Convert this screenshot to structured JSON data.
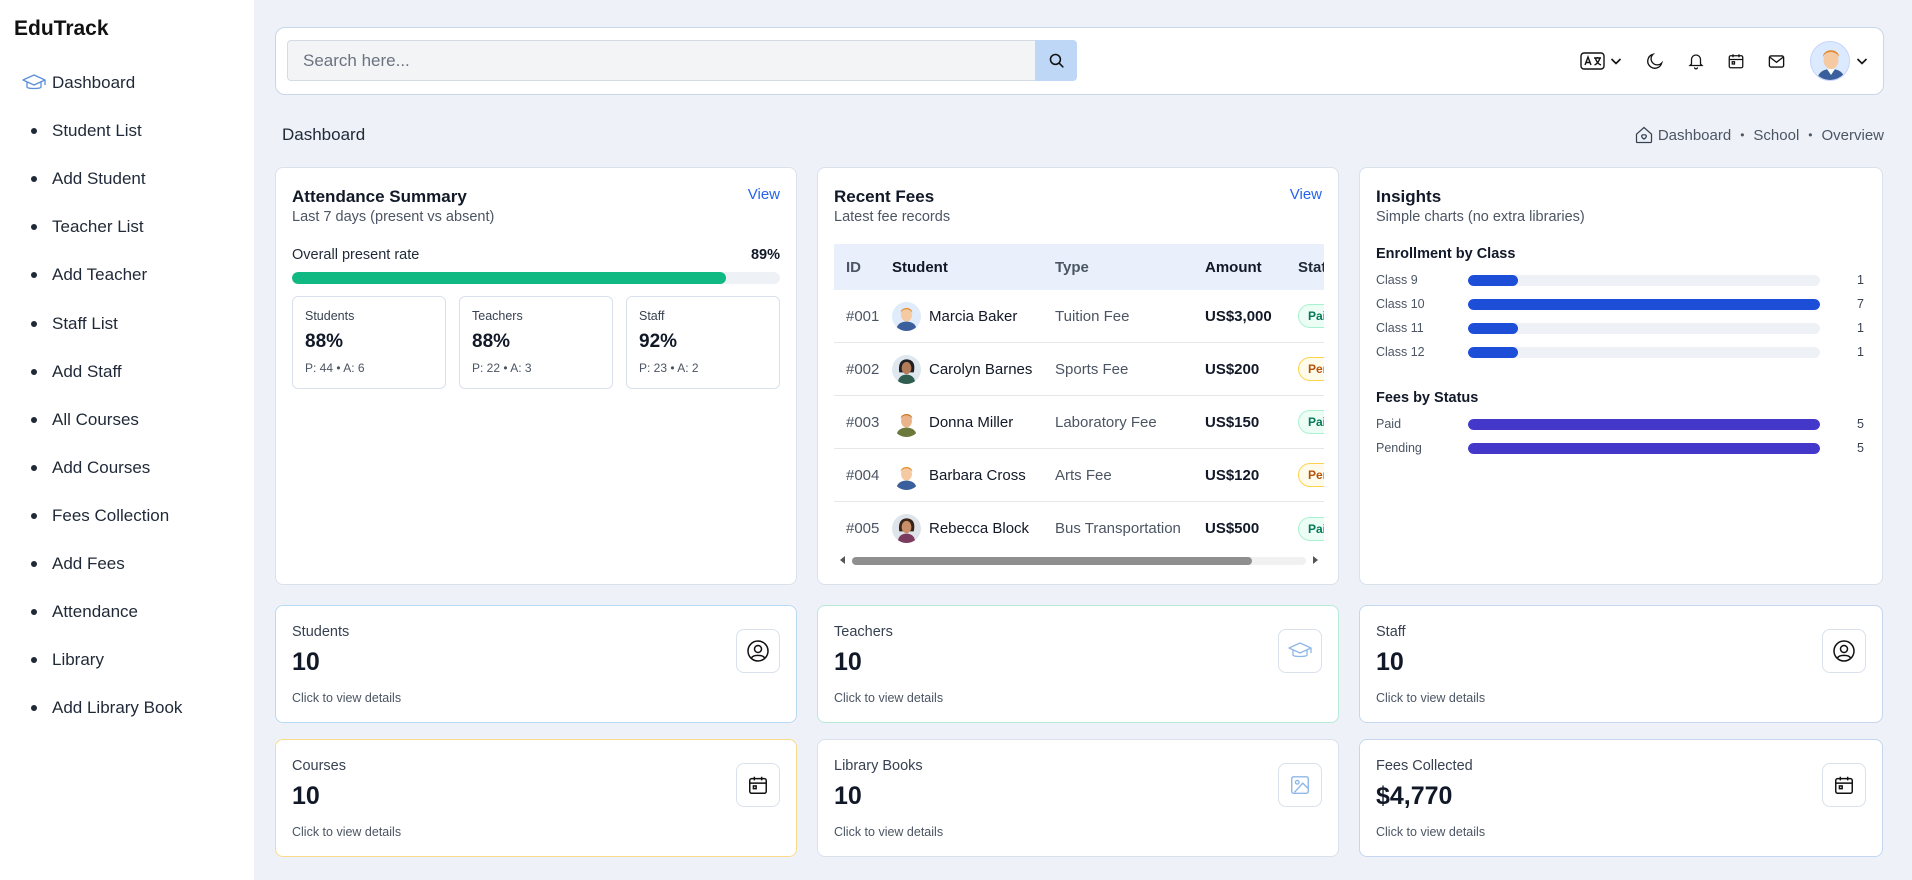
{
  "app": {
    "brand": "EduTrack"
  },
  "sidebar": {
    "items": [
      {
        "label": "Dashboard",
        "icon": "graduation-cap-icon"
      },
      {
        "label": "Student List"
      },
      {
        "label": "Add Student"
      },
      {
        "label": "Teacher List"
      },
      {
        "label": "Add Teacher"
      },
      {
        "label": "Staff List"
      },
      {
        "label": "Add Staff"
      },
      {
        "label": "All Courses"
      },
      {
        "label": "Add Courses"
      },
      {
        "label": "Fees Collection"
      },
      {
        "label": "Add Fees"
      },
      {
        "label": "Attendance"
      },
      {
        "label": "Library"
      },
      {
        "label": "Add Library Book"
      }
    ]
  },
  "topbar": {
    "search": {
      "placeholder": "Search here...",
      "value": ""
    },
    "icons": [
      "translate-icon",
      "chevron-down-icon",
      "moon-icon",
      "bell-icon",
      "calendar-icon",
      "mail-icon",
      "avatar",
      "chevron-down-icon"
    ]
  },
  "page": {
    "title": "Dashboard",
    "breadcrumb": [
      "Dashboard",
      "School",
      "Overview"
    ]
  },
  "attendance": {
    "title": "Attendance Summary",
    "subtitle": "Last 7 days (present vs absent)",
    "link": "View",
    "rate_label": "Overall present rate",
    "rate_text": "89%",
    "rate_fraction": 0.89,
    "boxes": [
      {
        "label": "Students",
        "value": "88%",
        "detail": "P: 44 • A: 6"
      },
      {
        "label": "Teachers",
        "value": "88%",
        "detail": "P: 22 • A: 3"
      },
      {
        "label": "Staff",
        "value": "92%",
        "detail": "P: 23 • A: 2"
      }
    ]
  },
  "fees": {
    "title": "Recent Fees",
    "subtitle": "Latest fee records",
    "link": "View",
    "columns": [
      "ID",
      "Student",
      "Type",
      "Amount",
      "Status"
    ],
    "rows": [
      {
        "id": "#001",
        "student": "Marcia Baker",
        "type": "Tuition Fee",
        "amount": "US$3,000",
        "status": "Paid"
      },
      {
        "id": "#002",
        "student": "Carolyn Barnes",
        "type": "Sports Fee",
        "amount": "US$200",
        "status": "Pending"
      },
      {
        "id": "#003",
        "student": "Donna Miller",
        "type": "Laboratory Fee",
        "amount": "US$150",
        "status": "Paid"
      },
      {
        "id": "#004",
        "student": "Barbara Cross",
        "type": "Arts Fee",
        "amount": "US$120",
        "status": "Pending"
      },
      {
        "id": "#005",
        "student": "Rebecca Block",
        "type": "Bus Transportation",
        "amount": "US$500",
        "status": "Paid"
      }
    ]
  },
  "insights": {
    "title": "Insights",
    "subtitle": "Simple charts (no extra libraries)",
    "enrollment": {
      "title": "Enrollment by Class",
      "color": "#1d4ed8",
      "max": 7,
      "items": [
        {
          "label": "Class 9",
          "value": 1
        },
        {
          "label": "Class 10",
          "value": 7
        },
        {
          "label": "Class 11",
          "value": 1
        },
        {
          "label": "Class 12",
          "value": 1
        }
      ]
    },
    "fees_status": {
      "title": "Fees by Status",
      "color": "#4338ca",
      "max": 5,
      "items": [
        {
          "label": "Paid",
          "value": 5
        },
        {
          "label": "Pending",
          "value": 5
        }
      ]
    }
  },
  "stats": [
    {
      "label": "Students",
      "value": "10",
      "hint": "Click to view details",
      "icon": "user-circle-icon",
      "border": "#b9daf2"
    },
    {
      "label": "Teachers",
      "value": "10",
      "hint": "Click to view details",
      "icon": "graduation-cap-icon",
      "border": "#b6ebd6"
    },
    {
      "label": "Staff",
      "value": "10",
      "hint": "Click to view details",
      "icon": "user-circle-icon",
      "border": "#c6d6ef"
    },
    {
      "label": "Courses",
      "value": "10",
      "hint": "Click to view details",
      "icon": "calendar-icon",
      "border": "#f7dc8c"
    },
    {
      "label": "Library Books",
      "value": "10",
      "hint": "Click to view details",
      "icon": "image-icon",
      "border": "#d9e1ec"
    },
    {
      "label": "Fees Collected",
      "value": "$4,770",
      "hint": "Click to view details",
      "icon": "calendar-icon",
      "border": "#c6d6ef"
    }
  ],
  "colors": {
    "accent": "#2563eb",
    "progress": "#10b981",
    "paid": "#047857",
    "pending": "#b45309"
  }
}
